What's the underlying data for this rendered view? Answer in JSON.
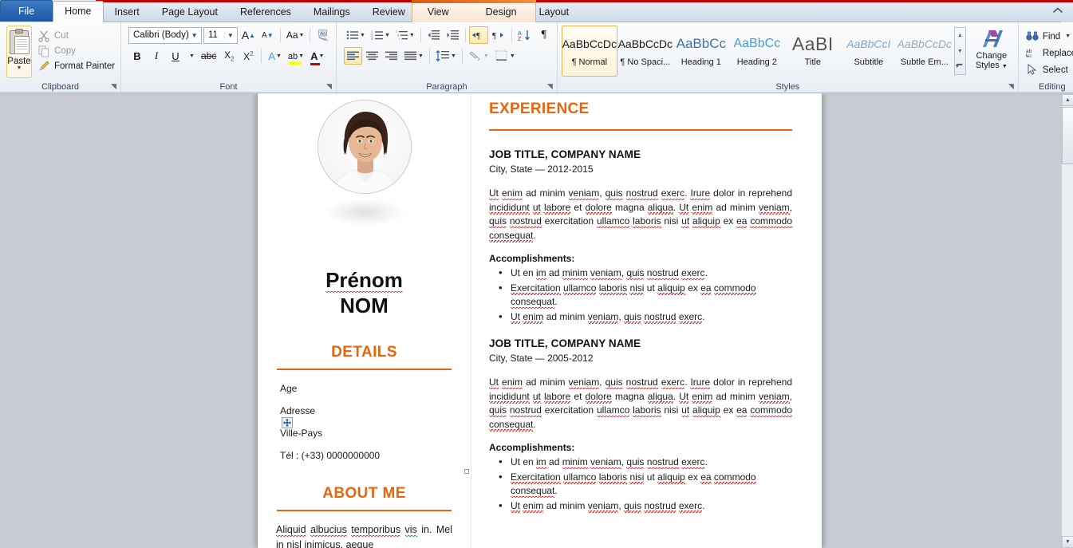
{
  "window": {
    "app": "Microsoft Word",
    "collapse_ribbon_icon": "chevron-up-icon"
  },
  "tabs": {
    "file": "File",
    "items": [
      {
        "label": "Home",
        "active": true
      },
      {
        "label": "Insert",
        "active": false
      },
      {
        "label": "Page Layout",
        "active": false
      },
      {
        "label": "References",
        "active": false
      },
      {
        "label": "Mailings",
        "active": false
      },
      {
        "label": "Review",
        "active": false
      },
      {
        "label": "View",
        "active": false
      }
    ],
    "contextual": [
      {
        "label": "Design"
      },
      {
        "label": "Layout"
      }
    ]
  },
  "ribbon": {
    "clipboard": {
      "title": "Clipboard",
      "paste": "Paste",
      "cut": "Cut",
      "copy": "Copy",
      "format_painter": "Format Painter",
      "launcher": "dialog-launcher"
    },
    "font": {
      "title": "Font",
      "font_name": "Calibri (Body)",
      "font_size": "11",
      "grow": "A",
      "shrink": "A",
      "change_case": "Aa",
      "clear_formatting": "clear-formatting",
      "bold": "B",
      "italic": "I",
      "underline": "U",
      "strikethrough": "abc",
      "subscript": "X",
      "superscript": "X",
      "text_effects": "A",
      "highlight": "ab",
      "font_color": "A",
      "launcher": "dialog-launcher"
    },
    "paragraph": {
      "title": "Paragraph",
      "bullets": "bullets",
      "numbering": "numbering",
      "multilevel": "multilevel-list",
      "decrease_indent": "decrease-indent",
      "increase_indent": "increase-indent",
      "ltr": "left-to-right",
      "rtl": "right-to-left",
      "sort": "sort",
      "show_marks": "¶",
      "align_left": "align-left",
      "align_center": "align-center",
      "align_right": "align-right",
      "justify": "justify",
      "line_spacing": "line-spacing",
      "shading": "shading",
      "borders": "borders",
      "launcher": "dialog-launcher"
    },
    "styles": {
      "title": "Styles",
      "items": [
        {
          "preview": "AaBbCcDc",
          "name": "¶ Normal",
          "selected": true,
          "color": "#1a1a1a",
          "size": "14px"
        },
        {
          "preview": "AaBbCcDc",
          "name": "¶ No Spaci...",
          "selected": false,
          "color": "#1a1a1a",
          "size": "14px"
        },
        {
          "preview": "AaBbCс",
          "name": "Heading 1",
          "selected": false,
          "color": "#3d72b8",
          "size": "17px"
        },
        {
          "preview": "AaBbCc",
          "name": "Heading 2",
          "selected": false,
          "color": "#4b9ad0",
          "size": "16px"
        },
        {
          "preview": "AaBІ",
          "name": "Title",
          "selected": false,
          "color": "#444444",
          "size": "22px"
        },
        {
          "preview": "AaBbCcI",
          "name": "Subtitle",
          "selected": false,
          "color": "#7ba7cf",
          "size": "14px"
        },
        {
          "preview": "AaBbCcDc",
          "name": "Subtle Em...",
          "selected": false,
          "color": "#9aa7b4",
          "size": "14px"
        }
      ],
      "scroll_up": "scroll-up",
      "scroll_down": "scroll-down",
      "more": "more-styles",
      "change_styles": "Change",
      "change_styles_2": "Styles",
      "launcher": "dialog-launcher"
    },
    "editing": {
      "title": "Editing",
      "find": "Find",
      "replace": "Replace",
      "select": "Select"
    }
  },
  "document": {
    "left_column": {
      "photo_alt": "profile-photo",
      "first_name": "Prénom",
      "last_name": "NOM",
      "details_heading": "DETAILS",
      "details": [
        "Age",
        "Adresse",
        "Ville-Pays",
        "Tél : (+33) 0000000000"
      ],
      "about_heading": "ABOUT ME",
      "about_text": "Aliquid albucius temporibus vis in. Mel in nisl inimicus, aeque"
    },
    "right_column": {
      "experience_heading": "EXPERIENCE",
      "jobs": [
        {
          "title": "JOB TITLE, COMPANY NAME",
          "meta": "City, State — 2012-2015",
          "body": "Ut enim ad minim veniam, quis nostrud exerc. Irure dolor in reprehend incididunt ut labore et dolore magna aliqua. Ut enim ad minim veniam, quis nostrud exercitation ullamco laboris nisi ut aliquip ex ea commodo consequat.",
          "accomplishments_heading": "Accomplishments:",
          "accomplishments": [
            "Ut en im ad minim veniam, quis nostrud exerc.",
            "Exercitation ullamco laboris nisi ut aliquip ex ea commodo consequat.",
            "Ut enim ad minim veniam, quis nostrud exerc."
          ]
        },
        {
          "title": "JOB TITLE, COMPANY NAME",
          "meta": "City, State — 2005-2012",
          "body": "Ut enim ad minim veniam, quis nostrud exerc. Irure dolor in reprehend incididunt ut labore et dolore magna aliqua. Ut enim ad minim veniam, quis nostrud exercitation ullamco laboris nisi ut aliquip ex ea commodo consequat.",
          "accomplishments_heading": "Accomplishments:",
          "accomplishments": [
            "Ut en im ad minim veniam, quis nostrud exerc.",
            "Exercitation ullamco laboris nisi ut aliquip ex ea commodo consequat.",
            "Ut enim ad minim veniam, quis nostrud exerc."
          ]
        }
      ]
    }
  },
  "colors": {
    "accent_orange": "#E8650D",
    "file_tab_blue": "#2F6AB5",
    "ribbon_red_accent": "#C00000",
    "heading_blue": "#3D72B8"
  },
  "scrollbar": {
    "up_arrow": "scroll-up-arrow",
    "down_arrow": "scroll-down-arrow",
    "thumb": "scroll-thumb"
  }
}
